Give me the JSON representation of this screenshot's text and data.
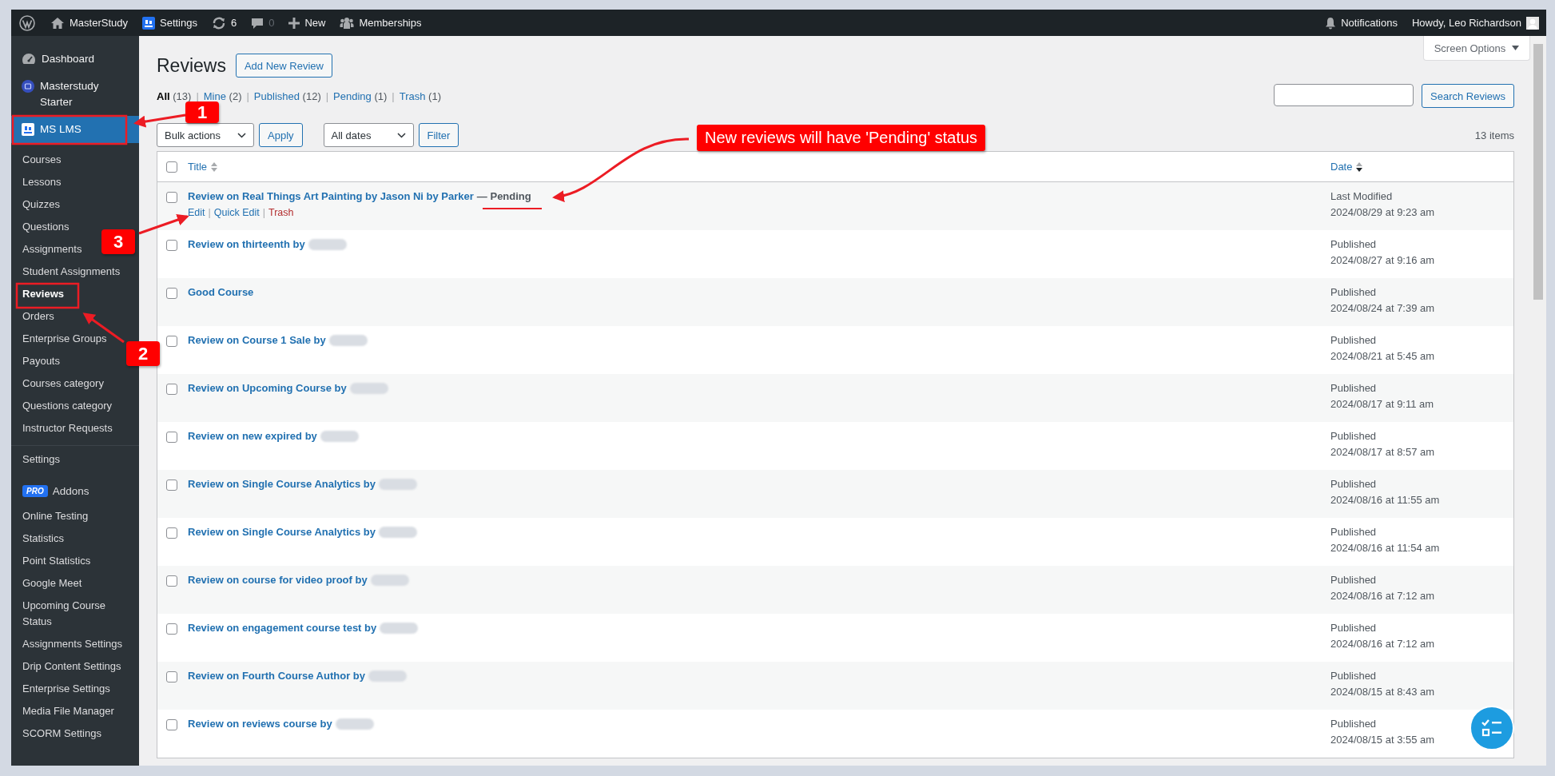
{
  "admin_bar": {
    "items": [
      {
        "kind": "wp"
      },
      {
        "kind": "home",
        "label": "MasterStudy"
      },
      {
        "kind": "ms",
        "label": "Settings"
      },
      {
        "kind": "updates",
        "label": "6"
      },
      {
        "kind": "comments",
        "label": "0"
      },
      {
        "kind": "new",
        "label": "New"
      },
      {
        "kind": "memberships",
        "label": "Memberships"
      }
    ],
    "notifications": "Notifications",
    "user": "Howdy, Leo Richardson"
  },
  "sidebar": {
    "menu": [
      {
        "kind": "dashboard",
        "label": "Dashboard",
        "selected": false
      },
      {
        "kind": "ms-circle",
        "label": "Masterstudy Starter",
        "selected": false
      },
      {
        "kind": "ms",
        "label": "MS LMS",
        "selected": true
      }
    ],
    "submenu": [
      {
        "label": "Courses",
        "selected": false
      },
      {
        "label": "Lessons",
        "selected": false
      },
      {
        "label": "Quizzes",
        "selected": false
      },
      {
        "label": "Questions",
        "selected": false
      },
      {
        "label": "Assignments",
        "selected": false
      },
      {
        "label": "Student Assignments",
        "selected": false
      },
      {
        "label": "Reviews",
        "selected": true
      },
      {
        "label": "Orders",
        "selected": false
      },
      {
        "label": "Enterprise Groups",
        "selected": false
      },
      {
        "label": "Payouts",
        "selected": false
      },
      {
        "label": "Courses category",
        "selected": false
      },
      {
        "label": "Questions category",
        "selected": false
      },
      {
        "label": "Instructor Requests",
        "selected": false
      }
    ],
    "settings": "Settings",
    "addons_badge": "PRO",
    "addons_label": "Addons",
    "addon_items": [
      "Online Testing",
      "Statistics",
      "Point Statistics",
      "Google Meet",
      "Upcoming Course Status",
      "Assignments Settings",
      "Drip Content Settings",
      "Enterprise Settings",
      "Media File Manager",
      "SCORM Settings"
    ]
  },
  "page": {
    "title": "Reviews",
    "add_button": "Add New Review",
    "screen_options": "Screen Options",
    "views": [
      {
        "label": "All",
        "count": "(13)",
        "selected": true
      },
      {
        "sep": "|",
        "label": "Mine",
        "count": "(2)",
        "selected": false
      },
      {
        "sep": "|",
        "label": "Published",
        "count": "(12)",
        "selected": false
      },
      {
        "sep": "|",
        "label": "Pending",
        "count": "(1)",
        "selected": false
      },
      {
        "sep": "|",
        "label": "Trash",
        "count": "(1)",
        "selected": false
      }
    ],
    "search_button": "Search Reviews",
    "bulk_actions": "Bulk actions",
    "apply": "Apply",
    "dates": "All dates",
    "filter": "Filter",
    "items_count": "13 items"
  },
  "table": {
    "columns": [
      "Title",
      "Date"
    ],
    "select_all_checked": false,
    "rows": [
      {
        "title": "Review on Real Things Art Painting by Jason Ni by Parker",
        "state": "— Pending",
        "actions": [
          {
            "label": "Edit",
            "kind": "normal"
          },
          {
            "sep": "|",
            "label": "Quick Edit",
            "kind": "normal"
          },
          {
            "sep": "|",
            "label": "Trash",
            "kind": "delete"
          }
        ],
        "checked": false,
        "redacted": false,
        "status": "Last Modified",
        "date": "2024/08/29 at 9:23 am"
      },
      {
        "title": "Review on thirteenth by",
        "checked": false,
        "redacted": true,
        "status": "Published",
        "date": "2024/08/27 at 9:16 am"
      },
      {
        "title": "Good Course",
        "checked": false,
        "redacted": false,
        "status": "Published",
        "date": "2024/08/24 at 7:39 am"
      },
      {
        "title": "Review on Course 1 Sale by",
        "checked": false,
        "redacted": true,
        "status": "Published",
        "date": "2024/08/21 at 5:45 am"
      },
      {
        "title": "Review on Upcoming Course by",
        "checked": false,
        "redacted": true,
        "status": "Published",
        "date": "2024/08/17 at 9:11 am"
      },
      {
        "title": "Review on new expired by",
        "checked": false,
        "redacted": true,
        "status": "Published",
        "date": "2024/08/17 at 8:57 am"
      },
      {
        "title": "Review on Single Course Analytics by",
        "checked": false,
        "redacted": true,
        "status": "Published",
        "date": "2024/08/16 at 11:55 am"
      },
      {
        "title": "Review on Single Course Analytics by",
        "checked": false,
        "redacted": true,
        "status": "Published",
        "date": "2024/08/16 at 11:54 am"
      },
      {
        "title": "Review on course for video proof by",
        "checked": false,
        "redacted": true,
        "status": "Published",
        "date": "2024/08/16 at 7:12 am"
      },
      {
        "title": "Review on engagement course test by",
        "checked": false,
        "redacted": true,
        "status": "Published",
        "date": "2024/08/16 at 7:12 am"
      },
      {
        "title": "Review on Fourth Course Author by",
        "checked": false,
        "redacted": true,
        "status": "Published",
        "date": "2024/08/15 at 8:43 am"
      },
      {
        "title": "Review on reviews course by",
        "checked": false,
        "redacted": true,
        "status": "Published",
        "date": "2024/08/15 at 3:55 am"
      }
    ]
  },
  "annotations": {
    "badges": [
      "1",
      "2",
      "3"
    ],
    "callout": "New reviews will have 'Pending' status"
  }
}
